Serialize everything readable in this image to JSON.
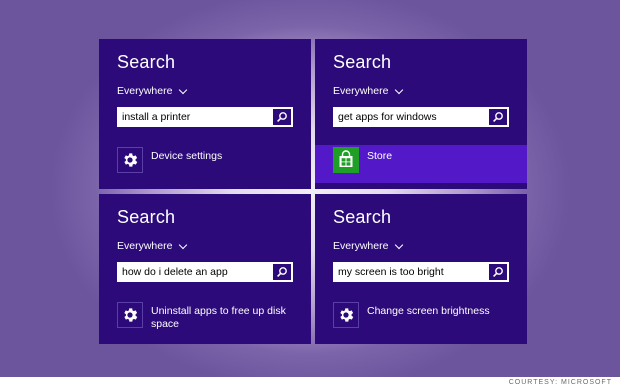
{
  "panels": [
    {
      "title": "Search",
      "scope": "Everywhere",
      "query": "install a printer",
      "result": {
        "label": "Device settings",
        "icon": "gear-icon",
        "selected": false
      }
    },
    {
      "title": "Search",
      "scope": "Everywhere",
      "query": "get apps for windows",
      "result": {
        "label": "Store",
        "icon": "store-bag-icon",
        "selected": true
      }
    },
    {
      "title": "Search",
      "scope": "Everywhere",
      "query": "how do i delete an app",
      "result": {
        "label": "Uninstall apps to free up disk space",
        "icon": "gear-icon",
        "selected": false
      }
    },
    {
      "title": "Search",
      "scope": "Everywhere",
      "query": "my screen is too bright",
      "result": {
        "label": "Change screen brightness",
        "icon": "gear-icon",
        "selected": false
      }
    }
  ],
  "credit": "COURTESY: MICROSOFT",
  "colors": {
    "panel_bg": "#2c0a79",
    "selected_bg": "#5319c9",
    "store_green": "#1f9f25"
  }
}
